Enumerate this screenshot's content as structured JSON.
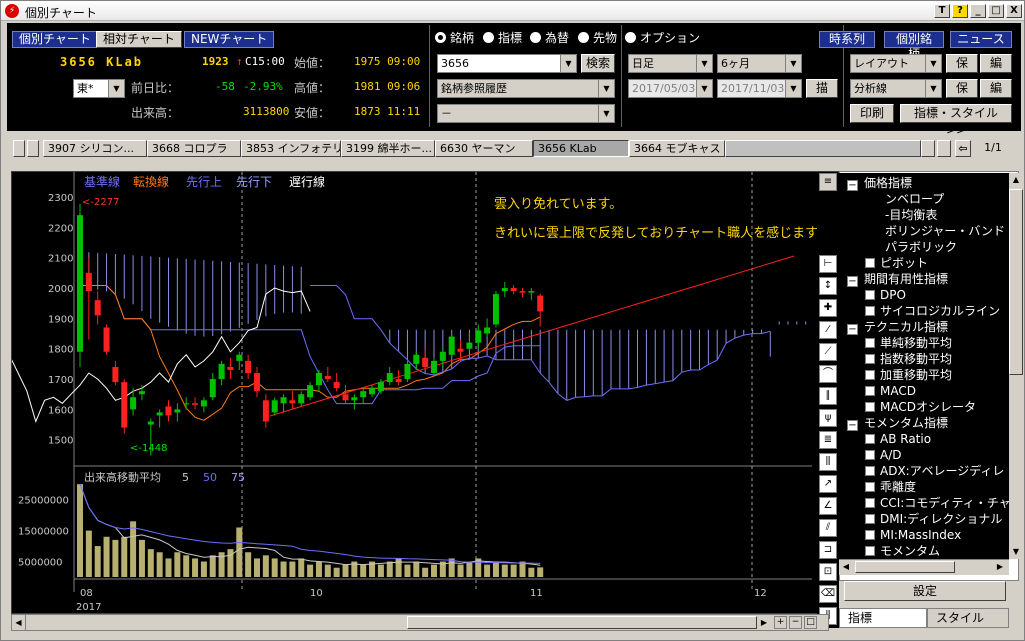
{
  "window": {
    "title": "個別チャート",
    "btn_t": "T",
    "btn_help": "?",
    "btn_min": "_",
    "btn_max": "□",
    "btn_close": "X"
  },
  "header": {
    "tab_kobetsu": "個別チャート",
    "tab_soutai": "相対チャート",
    "tab_new": "NEWチャート",
    "symbol": "3656 KLab",
    "last_price": "1923",
    "arrow": "↑",
    "time_label": "C15:00",
    "open_label": "始値：",
    "open_val": "1975 09:00",
    "prev_label": "前日比：",
    "change": "-58",
    "change_pct": "-2.93%",
    "high_label": "高値：",
    "high_val": "1981 09:06",
    "vol_label": "出来高：",
    "volume": "3113800",
    "low_label": "安値：",
    "low_val": "1873 11:11",
    "market_select": "東*"
  },
  "search": {
    "radios": [
      "銘柄",
      "指標",
      "為替",
      "先物",
      "オプション"
    ],
    "code_value": "3656",
    "search_btn": "検索",
    "history": "銘柄参照履歴",
    "blank": "－"
  },
  "period": {
    "interval": "日足",
    "range": "6ヶ月",
    "from": "2017/05/03",
    "to": "2017/11/03",
    "draw_btn": "描画"
  },
  "right_btns": {
    "series": "時系列",
    "stock": "個別銘柄",
    "news": "ニュース",
    "layout": "レイアウト",
    "save1": "保存",
    "edit1": "編集",
    "analysis": "分析線",
    "save2": "保存",
    "edit2": "編集",
    "print": "印刷",
    "indicator_style": "指標・スタイル>>"
  },
  "tabs": {
    "items": [
      "3907 シリコン...",
      "3668 コロプラ",
      "3853 インフォテリ",
      "3199 綿半ホー...",
      "6630 ヤーマン",
      "3656 KLab",
      "3664 モブキャス"
    ],
    "page": "1/1"
  },
  "legend": {
    "kijun": "基準線",
    "tenkan": "転換線",
    "senkou_a": "先行上",
    "senkou_b": "先行下",
    "chikou": "遅行線"
  },
  "annotation": {
    "line1": "雲入り免れています。",
    "line2": "きれいに雲上限で反発しておりチャート職人を感じます。"
  },
  "labels": {
    "max": "<-2277",
    "min": "<-1448",
    "vol_title": "出来高移動平均",
    "ma5": "5",
    "ma50": "50",
    "ma75": "75",
    "year": "2017"
  },
  "colors": {
    "kijun": "#6e6eff",
    "tenkan": "#ff7a1a",
    "senkou_a": "#6e6eff",
    "senkou_b": "#9aa0ff",
    "chikou": "#ffffff",
    "up": "#00c000",
    "down": "#ff2020",
    "trend": "#ff2020",
    "volume": "#b8b070"
  },
  "chart_data": {
    "type": "candlestick",
    "price_axis": [
      1500,
      1600,
      1700,
      1800,
      1900,
      2000,
      2100,
      2200,
      2300
    ],
    "volume_axis": [
      5000000,
      15000000,
      25000000
    ],
    "x_ticks": [
      "08",
      "10",
      "11",
      "12"
    ],
    "candles": [
      [
        1790,
        2277,
        1740,
        2240
      ],
      [
        2050,
        2100,
        1830,
        1990
      ],
      [
        1960,
        1990,
        1880,
        1910
      ],
      [
        1870,
        1880,
        1780,
        1790
      ],
      [
        1740,
        1760,
        1680,
        1690
      ],
      [
        1690,
        1700,
        1520,
        1540
      ],
      [
        1600,
        1670,
        1580,
        1640
      ],
      [
        1650,
        1680,
        1630,
        1660
      ],
      [
        1550,
        1570,
        1448,
        1560
      ],
      [
        1580,
        1600,
        1540,
        1590
      ],
      [
        1610,
        1630,
        1560,
        1580
      ],
      [
        1590,
        1620,
        1560,
        1600
      ],
      [
        1620,
        1640,
        1600,
        1620
      ],
      [
        1620,
        1640,
        1600,
        1615
      ],
      [
        1610,
        1640,
        1590,
        1630
      ],
      [
        1640,
        1720,
        1630,
        1700
      ],
      [
        1700,
        1760,
        1680,
        1750
      ],
      [
        1740,
        1770,
        1700,
        1730
      ],
      [
        1760,
        1790,
        1730,
        1780
      ],
      [
        1760,
        1780,
        1700,
        1720
      ],
      [
        1720,
        1740,
        1640,
        1660
      ],
      [
        1630,
        1650,
        1540,
        1560
      ],
      [
        1590,
        1640,
        1580,
        1630
      ],
      [
        1620,
        1650,
        1590,
        1640
      ],
      [
        1630,
        1660,
        1600,
        1620
      ],
      [
        1620,
        1660,
        1610,
        1650
      ],
      [
        1640,
        1690,
        1630,
        1680
      ],
      [
        1680,
        1730,
        1660,
        1720
      ],
      [
        1710,
        1740,
        1690,
        1700
      ],
      [
        1690,
        1720,
        1660,
        1670
      ],
      [
        1650,
        1680,
        1620,
        1630
      ],
      [
        1630,
        1650,
        1600,
        1640
      ],
      [
        1640,
        1670,
        1620,
        1660
      ],
      [
        1650,
        1680,
        1640,
        1670
      ],
      [
        1660,
        1700,
        1650,
        1690
      ],
      [
        1690,
        1740,
        1680,
        1720
      ],
      [
        1700,
        1730,
        1680,
        1690
      ],
      [
        1700,
        1760,
        1690,
        1750
      ],
      [
        1750,
        1790,
        1730,
        1780
      ],
      [
        1770,
        1800,
        1730,
        1740
      ],
      [
        1720,
        1770,
        1710,
        1760
      ],
      [
        1760,
        1800,
        1740,
        1790
      ],
      [
        1780,
        1850,
        1770,
        1840
      ],
      [
        1800,
        1830,
        1760,
        1790
      ],
      [
        1800,
        1850,
        1790,
        1820
      ],
      [
        1820,
        1880,
        1800,
        1860
      ],
      [
        1850,
        1900,
        1840,
        1870
      ],
      [
        1880,
        1990,
        1870,
        1980
      ],
      [
        1990,
        2020,
        1970,
        2000
      ],
      [
        2000,
        2010,
        1980,
        1990
      ],
      [
        1990,
        2000,
        1970,
        1985
      ],
      [
        1985,
        2000,
        1960,
        1990
      ],
      [
        1975,
        1981,
        1873,
        1923
      ]
    ],
    "volumes": [
      30000000,
      15000000,
      10000000,
      13000000,
      12000000,
      13000000,
      18000000,
      12000000,
      9000000,
      8000000,
      6000000,
      8000000,
      7000000,
      6000000,
      5000000,
      7000000,
      8000000,
      9000000,
      16000000,
      8000000,
      6000000,
      7000000,
      6000000,
      5000000,
      5000000,
      6000000,
      4000000,
      5000000,
      4000000,
      3000000,
      4000000,
      5000000,
      4000000,
      5000000,
      4000000,
      5000000,
      6000000,
      4000000,
      5000000,
      3000000,
      4000000,
      5000000,
      6000000,
      4000000,
      5000000,
      6000000,
      4000000,
      5000000,
      4000000,
      4000000,
      5000000,
      3000000,
      3113800
    ]
  }
}
